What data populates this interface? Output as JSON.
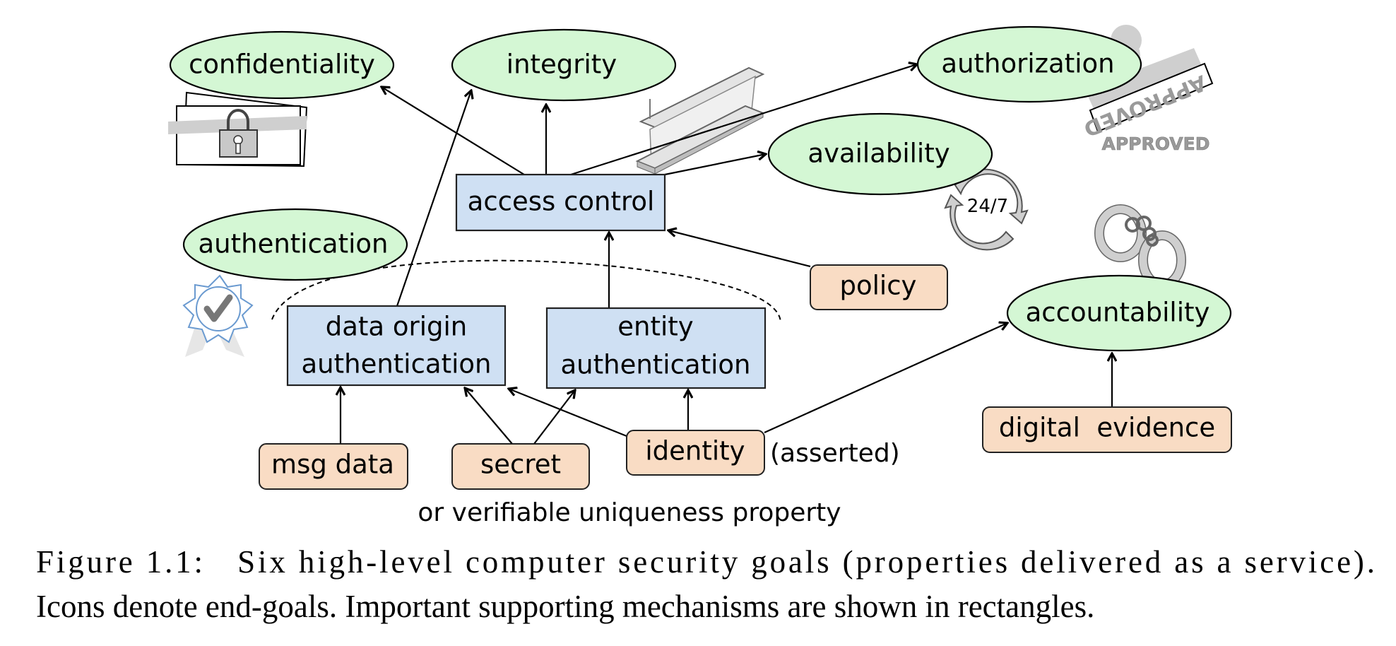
{
  "figure": {
    "goals": {
      "confidentiality": "confidentiality",
      "integrity": "integrity",
      "authorization": "authorization",
      "availability": "availability",
      "authentication": "authentication",
      "accountability": "accountability"
    },
    "mechanisms": {
      "access_control": "access control",
      "data_origin_line1": "data origin",
      "data_origin_line2": "authentication",
      "entity_line1": "entity",
      "entity_line2": "authentication"
    },
    "inputs": {
      "msg_data": "msg data",
      "secret": "secret",
      "identity": "identity",
      "policy": "policy",
      "digital_evidence": "digital  evidence"
    },
    "annotations": {
      "asserted": "(asserted)",
      "uniqueness": "or verifiable uniqueness property",
      "stamp_text": "APPROVED",
      "stamp_mirrored": "APPROVED",
      "clock_text": "24/7"
    },
    "icons": {
      "confidentiality": "locked-envelope-icon",
      "integrity": "steel-beam-icon",
      "authorization": "approved-stamp-icon",
      "availability": "24-7-cycle-icon",
      "authentication": "certified-badge-icon",
      "accountability": "handcuffs-icon"
    },
    "colors": {
      "goal_fill": "#d4f7d4",
      "mechanism_fill": "#cfe0f3",
      "input_fill": "#f9dcc4"
    }
  },
  "caption": {
    "line1": "Figure 1.1:   Six high-level computer security goals (properties delivered as a service).",
    "line2": "Icons denote end-goals. Important supporting mechanisms are shown in rectangles."
  }
}
